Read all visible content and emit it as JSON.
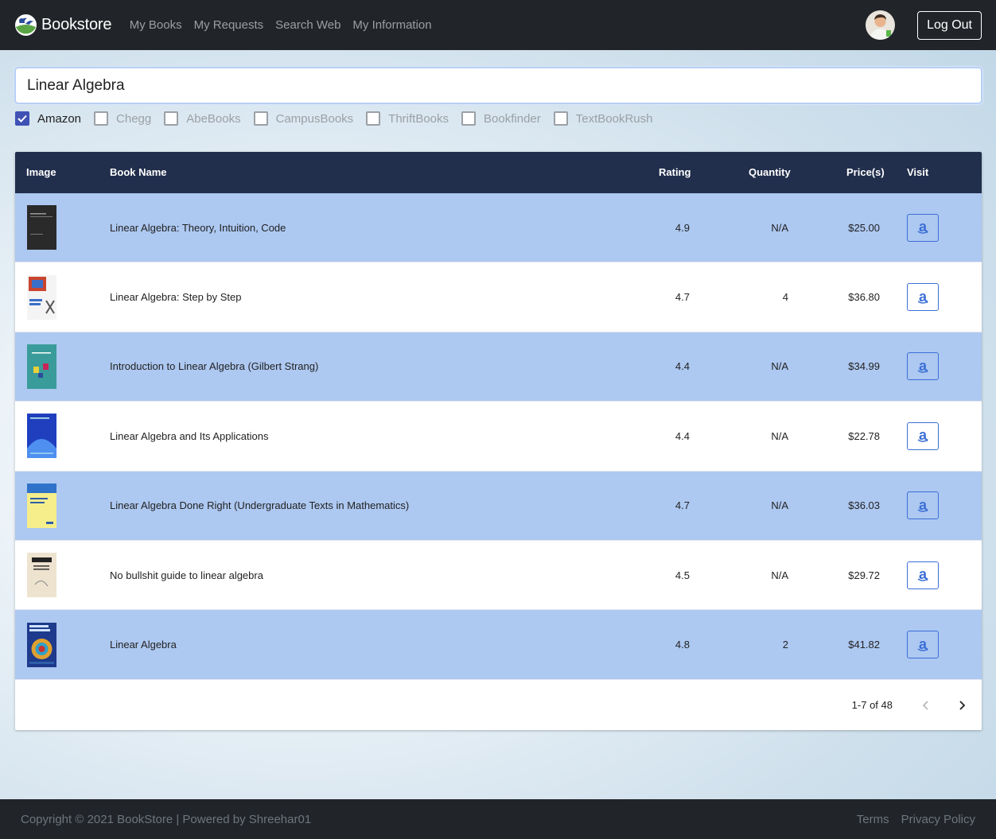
{
  "navbar": {
    "brand": "Bookstore",
    "links": [
      "My Books",
      "My Requests",
      "Search Web",
      "My Information"
    ],
    "logout_label": "Log Out"
  },
  "search": {
    "value": "Linear Algebra"
  },
  "filters": [
    {
      "label": "Amazon",
      "checked": true
    },
    {
      "label": "Chegg",
      "checked": false
    },
    {
      "label": "AbeBooks",
      "checked": false
    },
    {
      "label": "CampusBooks",
      "checked": false
    },
    {
      "label": "ThriftBooks",
      "checked": false
    },
    {
      "label": "Bookfinder",
      "checked": false
    },
    {
      "label": "TextBookRush",
      "checked": false
    }
  ],
  "table": {
    "headers": {
      "image": "Image",
      "name": "Book Name",
      "rating": "Rating",
      "quantity": "Quantity",
      "price": "Price(s)",
      "visit": "Visit"
    },
    "rows": [
      {
        "name": "Linear Algebra: Theory, Intuition, Code",
        "rating": "4.9",
        "quantity": "N/A",
        "price": "$25.00",
        "cover": "dark"
      },
      {
        "name": "Linear Algebra: Step by Step",
        "rating": "4.7",
        "quantity": "4",
        "price": "$36.80",
        "cover": "white"
      },
      {
        "name": "Introduction to Linear Algebra (Gilbert Strang)",
        "rating": "4.4",
        "quantity": "N/A",
        "price": "$34.99",
        "cover": "teal"
      },
      {
        "name": "Linear Algebra and Its Applications",
        "rating": "4.4",
        "quantity": "N/A",
        "price": "$22.78",
        "cover": "blue"
      },
      {
        "name": "Linear Algebra Done Right (Undergraduate Texts in Mathematics)",
        "rating": "4.7",
        "quantity": "N/A",
        "price": "$36.03",
        "cover": "yellow"
      },
      {
        "name": "No bullshit guide to linear algebra",
        "rating": "4.5",
        "quantity": "N/A",
        "price": "$29.72",
        "cover": "beige"
      },
      {
        "name": "Linear Algebra",
        "rating": "4.8",
        "quantity": "2",
        "price": "$41.82",
        "cover": "colorful"
      }
    ],
    "pagination": "1-7 of 48"
  },
  "footer": {
    "copyright": "Copyright © 2021 BookStore | Powered by Shreehar01",
    "links": [
      "Terms",
      "Privacy Policy"
    ]
  },
  "colors": {
    "navbar": "#212529",
    "table_header": "#212e4c",
    "row_highlight": "#adc8f1",
    "accent": "#3f51b5",
    "amazon_button": "#3b6fd6"
  }
}
